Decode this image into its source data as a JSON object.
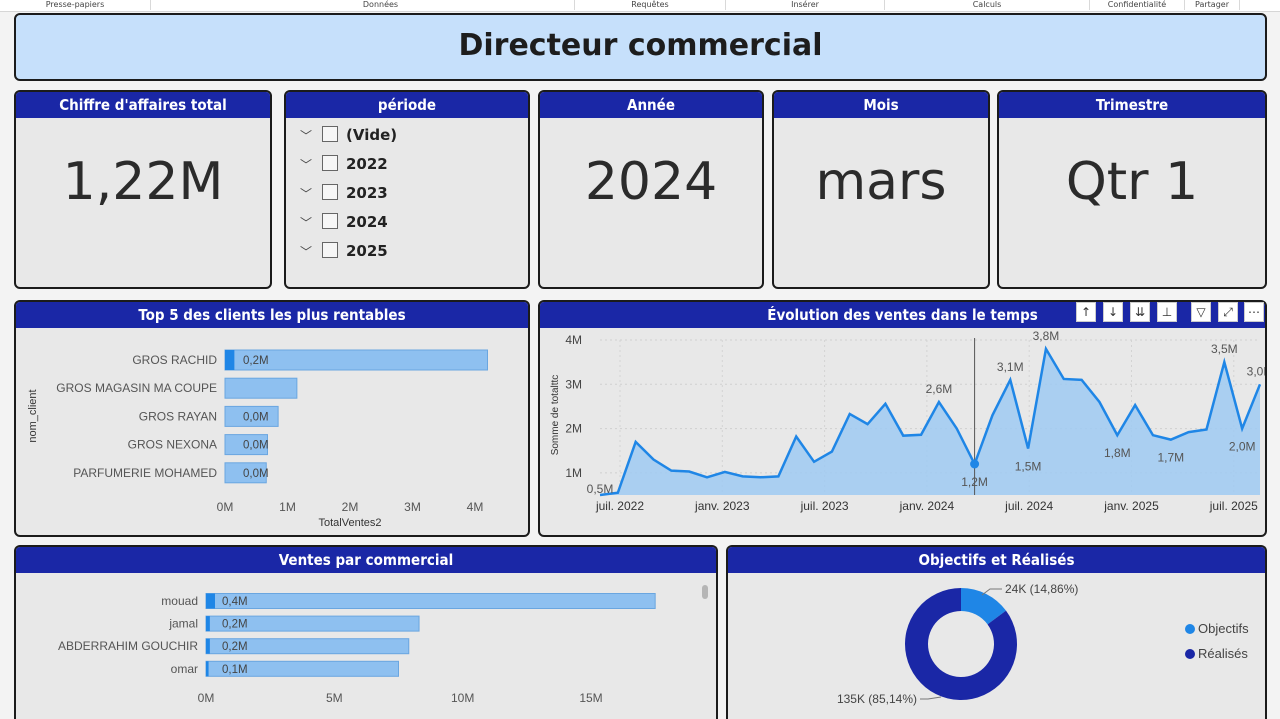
{
  "ribbon": [
    "Presse-papiers",
    "Données",
    "Requêtes",
    "Insérer",
    "Calculs",
    "Confidentialité",
    "Partager"
  ],
  "title": "Directeur commercial",
  "kpis": {
    "revenue_title": "Chiffre d'affaires total",
    "revenue_value": "1,22M",
    "year_title": "Année",
    "year_value": "2024",
    "month_title": "Mois",
    "month_value": "mars",
    "quarter_title": "Trimestre",
    "quarter_value": "Qtr 1"
  },
  "period": {
    "title": "période",
    "items": [
      "(Vide)",
      "2022",
      "2023",
      "2024",
      "2025"
    ]
  },
  "toolbar_icons": [
    "arrow-up-icon",
    "arrow-down-icon",
    "double-arrow-down-icon",
    "drill-icon",
    "filter-icon",
    "focus-mode-icon",
    "more-options-icon"
  ],
  "colors": {
    "header": "#1a27a6",
    "bar": "#8ec0f0",
    "bar_highlight": "#1f86e6",
    "line": "#1f86e6",
    "donut_dark": "#1a27a6",
    "donut_light": "#1f86e6"
  },
  "chart_data": [
    {
      "type": "bar",
      "title": "Top 5 des clients les plus rentables",
      "ylabel": "nom_client",
      "xlabel": "TotalVentes2",
      "categories": [
        "GROS RACHID",
        "GROS MAGASIN MA COUPE",
        "GROS RAYAN",
        "GROS NEXONA",
        "PARFUMERIE MOHAMED"
      ],
      "values": [
        4.2,
        1.15,
        0.85,
        0.68,
        0.66
      ],
      "highlight_values": [
        0.15,
        0,
        0,
        0,
        0
      ],
      "labels": [
        "0,2M",
        "",
        "0,0M",
        "0,0M",
        "0,0M"
      ],
      "xticks": [
        "0M",
        "1M",
        "2M",
        "3M",
        "4M"
      ],
      "xlim": [
        0,
        4
      ]
    },
    {
      "type": "area",
      "title": "Évolution des ventes dans le temps",
      "ylabel": "Somme de totalttc",
      "xticks": [
        "juil. 2022",
        "janv. 2023",
        "juil. 2023",
        "janv. 2024",
        "juil. 2024",
        "janv. 2025",
        "juil. 2025"
      ],
      "yticks": [
        "1M",
        "2M",
        "3M",
        "4M"
      ],
      "ylim": [
        0.5,
        4
      ],
      "xlim": [
        0,
        36
      ],
      "x": [
        0,
        1,
        2,
        3,
        4,
        5,
        6,
        7,
        8,
        9,
        10,
        11,
        12,
        13,
        14,
        15,
        16,
        17,
        18,
        19,
        20,
        21,
        22,
        23,
        24,
        25,
        26,
        27,
        28,
        29,
        30,
        31,
        32,
        33,
        34,
        35,
        36
      ],
      "y": [
        0.5,
        0.55,
        1.7,
        1.3,
        1.05,
        1.03,
        0.9,
        1.02,
        0.92,
        0.9,
        0.92,
        1.82,
        1.25,
        1.48,
        2.33,
        2.1,
        2.56,
        1.84,
        1.86,
        2.6,
        2.0,
        1.2,
        2.3,
        3.1,
        1.55,
        3.8,
        3.12,
        3.1,
        2.6,
        1.85,
        2.53,
        1.85,
        1.75,
        1.92,
        1.98,
        3.5,
        2.0,
        3.0
      ],
      "annotations": [
        {
          "x": 0,
          "y": 0.5,
          "label": "0,5M"
        },
        {
          "x": 19,
          "y": 2.6,
          "label": "2,6M"
        },
        {
          "x": 21,
          "y": 1.2,
          "label": "1,2M"
        },
        {
          "x": 23,
          "y": 3.1,
          "label": "3,1M"
        },
        {
          "x": 24,
          "y": 1.55,
          "label": "1,5M"
        },
        {
          "x": 25,
          "y": 3.8,
          "label": "3,8M"
        },
        {
          "x": 29,
          "y": 1.85,
          "label": "1,8M"
        },
        {
          "x": 32,
          "y": 1.75,
          "label": "1,7M"
        },
        {
          "x": 35,
          "y": 3.5,
          "label": "3,5M"
        },
        {
          "x": 36,
          "y": 2.0,
          "label": "2,0M"
        },
        {
          "x": 37,
          "y": 3.0,
          "label": "3,0M"
        }
      ]
    },
    {
      "type": "bar",
      "title": "Ventes par commercial",
      "categories": [
        "mouad",
        "jamal",
        "ABDERRAHIM GOUCHIR",
        "omar"
      ],
      "values": [
        17.5,
        8.3,
        7.9,
        7.5
      ],
      "highlight_values": [
        0.35,
        0.15,
        0.15,
        0.1
      ],
      "labels": [
        "0,4M",
        "0,2M",
        "0,2M",
        "0,1M"
      ],
      "xticks": [
        "0M",
        "5M",
        "10M",
        "15M"
      ],
      "xlim": [
        0,
        15
      ]
    },
    {
      "type": "pie",
      "title": "Objectifs et Réalisés",
      "slices": [
        {
          "name": "Objectifs",
          "value": 14.86,
          "label": "24K (14,86%)"
        },
        {
          "name": "Réalisés",
          "value": 85.14,
          "label": "135K (85,14%)"
        }
      ],
      "legend": "right"
    }
  ]
}
